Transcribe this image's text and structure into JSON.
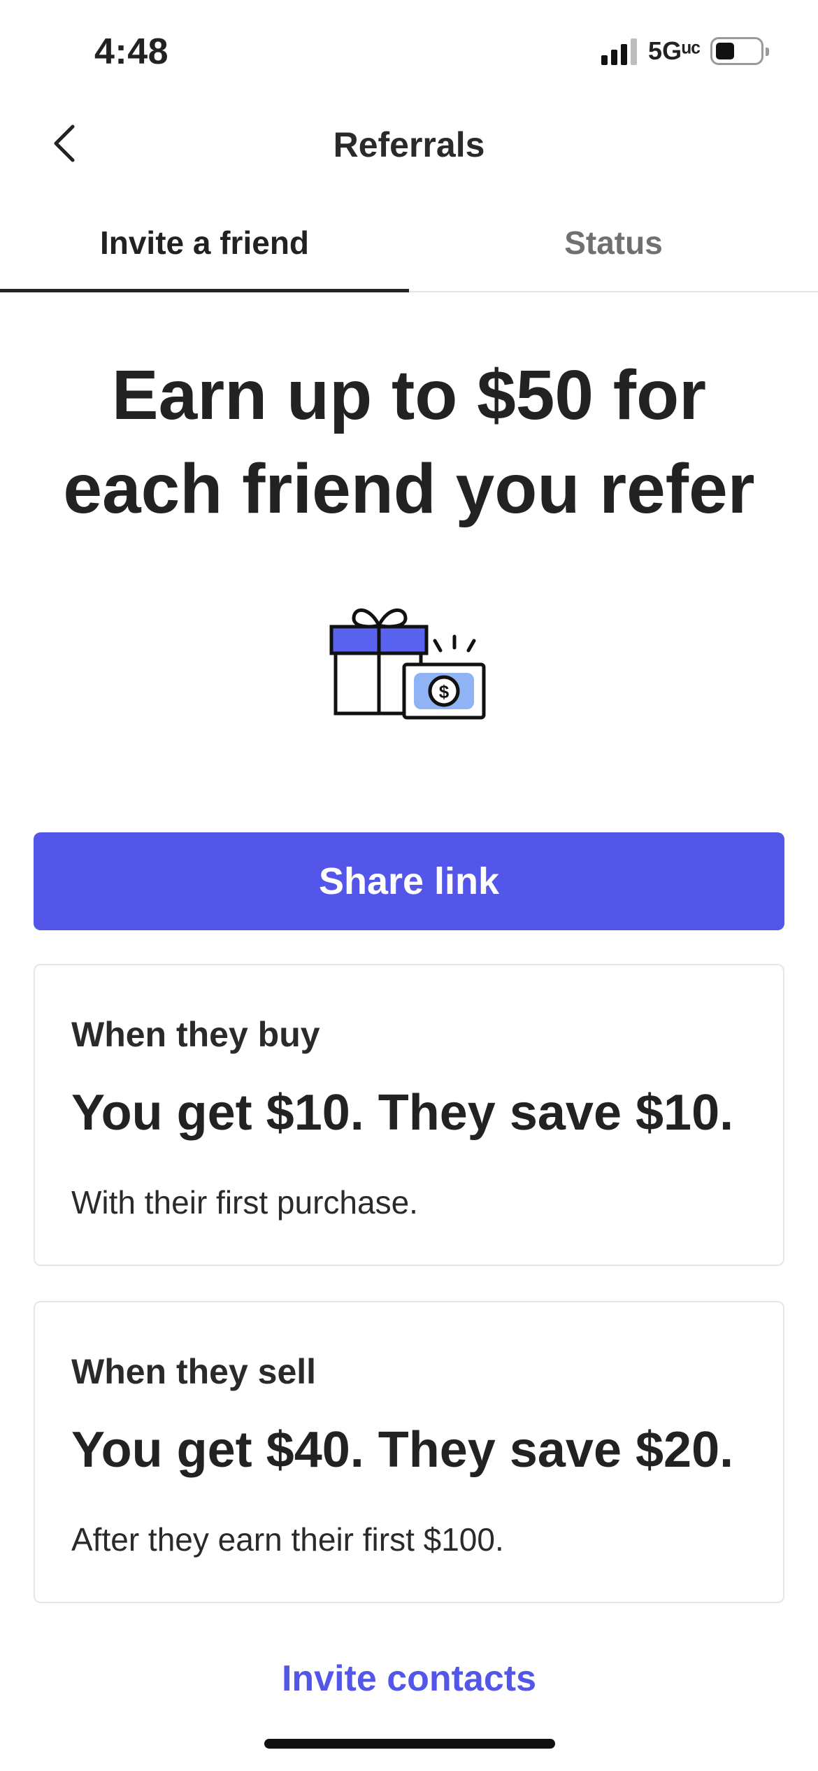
{
  "status_bar": {
    "time": "4:48",
    "network": "5Gᵘᶜ"
  },
  "header": {
    "title": "Referrals",
    "back_icon": "chevron-left-icon"
  },
  "tabs": [
    {
      "label": "Invite a friend",
      "active": true
    },
    {
      "label": "Status",
      "active": false
    }
  ],
  "hero": {
    "headline_line1": "Earn up to $50 for",
    "headline_line2": "each friend you refer",
    "illustration_icon": "gift-and-cash-icon"
  },
  "share_button": {
    "label": "Share link"
  },
  "cards": [
    {
      "label": "When they buy",
      "amount": "You get $10. They save $10.",
      "note": "With their first purchase."
    },
    {
      "label": "When they sell",
      "amount": "You get $40. They save $20.",
      "note": "After they earn their first $100."
    }
  ],
  "invite_contacts": {
    "label": "Invite contacts"
  },
  "colors": {
    "accent": "#5356e9",
    "illustration_fill": "#5a62f0",
    "cash_fill": "#8fb3f5",
    "text": "#222222"
  }
}
